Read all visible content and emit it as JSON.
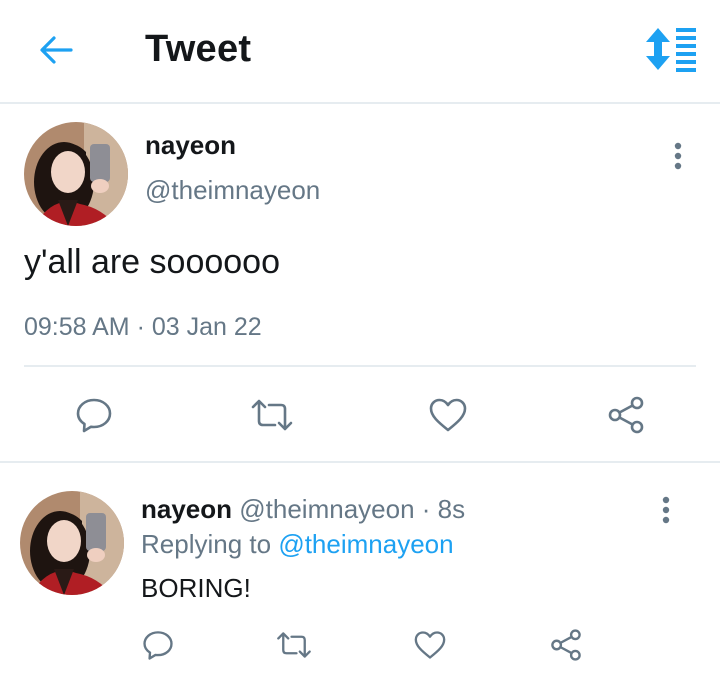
{
  "header": {
    "title": "Tweet",
    "back_icon": "arrow-left-icon",
    "sort_icon": "sort-list-icon",
    "accent": "#1da1f2"
  },
  "tweet": {
    "name": "nayeon",
    "handle": "@theimnayeon",
    "text": "y'all are soooooo",
    "timestamp": "09:58 AM · 03 Jan 22",
    "actions": [
      "reply-icon",
      "retweet-icon",
      "like-icon",
      "share-icon"
    ]
  },
  "reply": {
    "name": "nayeon",
    "handle_time": "@theimnayeon · 8s",
    "replying_prefix": "Replying to",
    "replying_handle": "@theimnayeon",
    "text": "BORING!",
    "actions": [
      "reply-icon",
      "retweet-icon",
      "like-icon",
      "share-icon"
    ]
  },
  "colors": {
    "text": "#14171a",
    "secondary": "#657786",
    "divider": "#e6ecf0",
    "link": "#1da1f2"
  }
}
